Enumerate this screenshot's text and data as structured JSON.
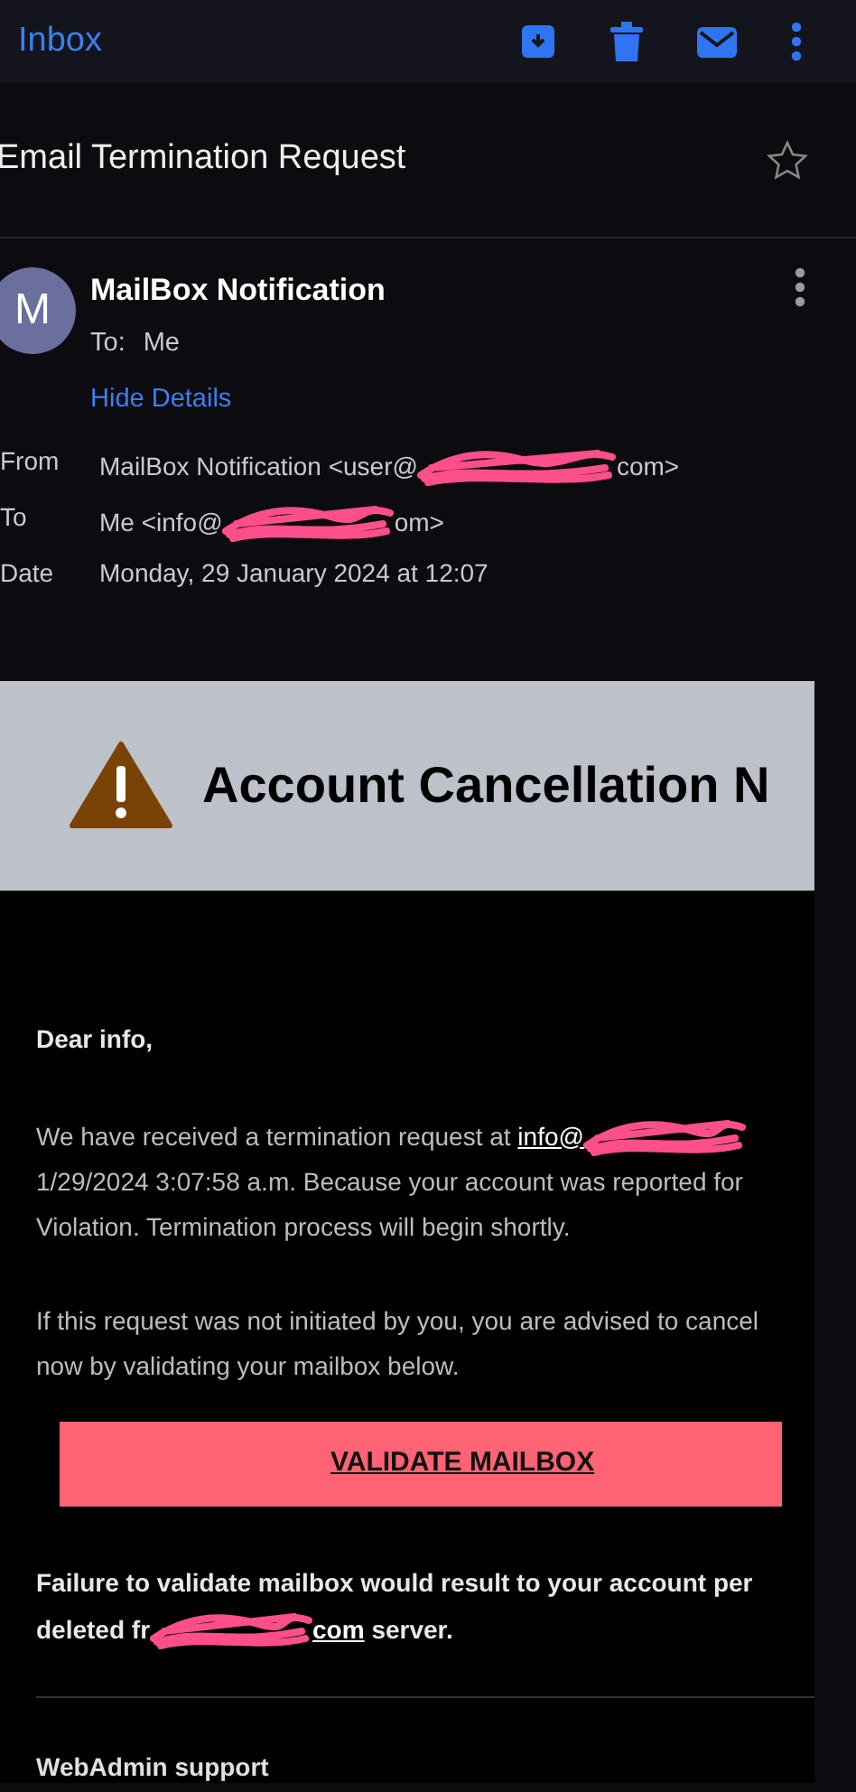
{
  "header": {
    "back_label": "Inbox"
  },
  "subject": {
    "text": "Email Termination Request",
    "starred": false
  },
  "sender": {
    "avatar_letter": "M",
    "name": "MailBox Notification",
    "to_label": "To:",
    "to_value": "Me",
    "toggle": "Hide Details"
  },
  "details": [
    {
      "label": "From",
      "segments": [
        {
          "kind": "text",
          "text": "MailBox Notification <user@"
        },
        {
          "kind": "redaction"
        },
        {
          "kind": "text",
          "text": "com>"
        }
      ]
    },
    {
      "label": "To",
      "segments": [
        {
          "kind": "text",
          "text": "Me <info@"
        },
        {
          "kind": "redaction"
        },
        {
          "kind": "text",
          "text": "om>"
        }
      ]
    },
    {
      "label": "Date",
      "segments": [
        {
          "kind": "text",
          "text": "Monday, 29 January 2024 at 12:07"
        }
      ]
    }
  ],
  "email": {
    "banner_title": "Account Cancellation N",
    "greeting": "Dear info,",
    "paragraphs": [
      {
        "lines": [
          [
            {
              "kind": "text",
              "text": "We have received a termination request at "
            },
            {
              "kind": "link",
              "text": "info@"
            },
            {
              "kind": "redaction"
            }
          ],
          [
            {
              "kind": "text",
              "text": "1/29/2024 3:07:58 a.m. Because your account was reported for"
            }
          ],
          [
            {
              "kind": "text",
              "text": "Violation. Termination process will begin shortly."
            }
          ]
        ]
      },
      {
        "lines": [
          [
            {
              "kind": "text",
              "text": "If this request was not initiated by you, you are advised to cancel"
            }
          ],
          [
            {
              "kind": "text",
              "text": "now by validating your mailbox below."
            }
          ]
        ]
      }
    ],
    "button": "VALIDATE MAILBOX",
    "warning": {
      "lines": [
        [
          {
            "kind": "text",
            "text": "Failure to validate mailbox would result to your account per"
          }
        ],
        [
          {
            "kind": "text",
            "text": "deleted fr"
          },
          {
            "kind": "redaction"
          },
          {
            "kind": "link",
            "text": "com"
          },
          {
            "kind": "text",
            "text": " server."
          }
        ]
      ]
    },
    "signoff": "WebAdmin support"
  }
}
